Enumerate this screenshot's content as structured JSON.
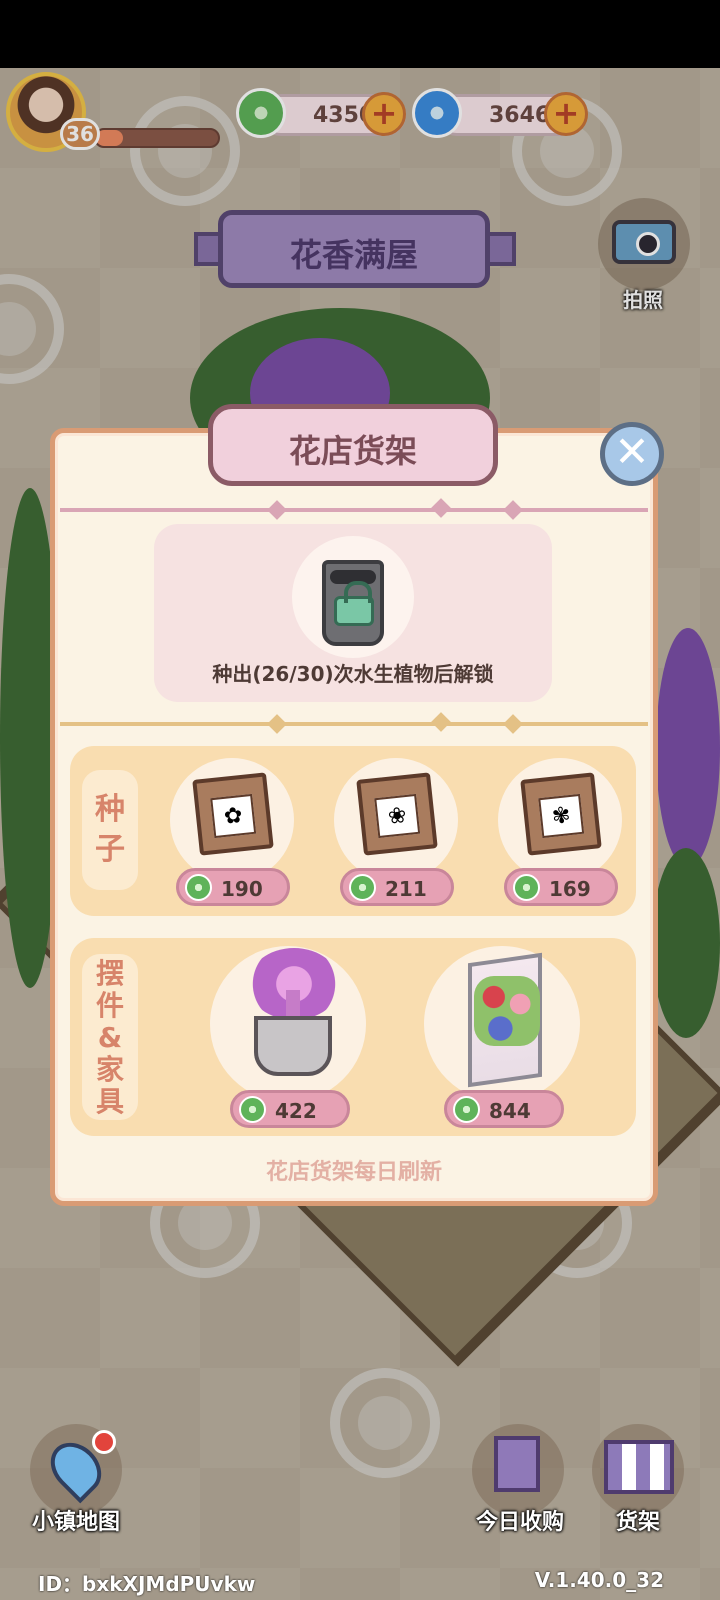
{
  "hud": {
    "level": "36",
    "xp_fraction": 0.22,
    "clover_currency": "4350",
    "swirl_currency": "3646",
    "clover_icon": "clover-icon",
    "swirl_icon": "swirl-icon",
    "plus_icon": "+"
  },
  "area": {
    "title": "花香满屋"
  },
  "camera": {
    "label": "拍照"
  },
  "shop": {
    "title": "花店货架",
    "close_icon": "✕",
    "lock_text": "种出(26/30)次水生植物后解锁",
    "seeds_label": "种子",
    "seeds": [
      {
        "price": "190",
        "picture": "daffodil"
      },
      {
        "price": "211",
        "picture": "orange-flower"
      },
      {
        "price": "169",
        "picture": "water-lily"
      }
    ],
    "decor_label": "摆件&家具",
    "decor": [
      {
        "price": "422",
        "item": "purple-potted-plant"
      },
      {
        "price": "844",
        "item": "flower-shelf"
      }
    ],
    "refresh_note": "花店货架每日刷新"
  },
  "nav": {
    "map_label": "小镇地图",
    "today_label": "今日收购",
    "shelf_label": "货架"
  },
  "footer": {
    "id": "ID：bxkXJMdPUvkw",
    "version": "V.1.40.0_32"
  },
  "colors": {
    "modal_bg": "#fbf3e4",
    "modal_border": "#d99b74",
    "section_bg": "#f9ddb0",
    "price_tag": "#e6a1b4",
    "accent_purple": "#a18bc0"
  }
}
